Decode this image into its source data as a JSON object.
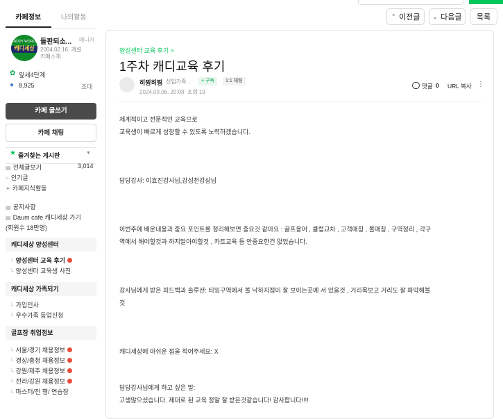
{
  "top": {
    "prev_label": "이전글",
    "next_label": "다음글",
    "list_label": "목록"
  },
  "sidebar": {
    "tabs": [
      "카페정보",
      "나의활동"
    ],
    "cafe": {
      "logo_text": "캐디세상",
      "name": "들판되소...",
      "role": "매니저",
      "date": "2004.02.16. 개설",
      "intro": "카페소개",
      "level": "잎새4단계",
      "member_count": "8,925",
      "invite": "초대"
    },
    "write_button": "카페 글쓰기",
    "chat_button": "카페 채팅",
    "favorites": "즐겨찾는 게시판",
    "menu1": [
      {
        "label": "전체글보기",
        "count": "3,014"
      },
      {
        "label": "인기글"
      },
      {
        "label": "카페지식활동"
      }
    ],
    "menu2": [
      {
        "label": "공지사항"
      },
      {
        "label": "Daum cafe 캐디세상 가기"
      },
      {
        "label": "(회원수 18만명)"
      }
    ],
    "section1": {
      "title": "캐디세상 양성센터",
      "items": [
        {
          "label": "양성센터 교육 후기",
          "new": true,
          "active": true
        },
        {
          "label": "양성센터 교육생 사진"
        }
      ]
    },
    "section2": {
      "title": "캐디세상 가족되기",
      "items": [
        {
          "label": "가입인사"
        },
        {
          "label": "우수가족 등업신청"
        }
      ]
    },
    "section3": {
      "title": "골프장 취업정보",
      "items": [
        {
          "label": "서울/경기 채용정보",
          "new": true
        },
        {
          "label": "경상/충청 채용정보",
          "new": true
        },
        {
          "label": "강원/제주 채용정보",
          "new": true
        },
        {
          "label": "전라/강원 채용정보",
          "new": true
        },
        {
          "label": "마스터/진 행/ 연습장"
        }
      ]
    }
  },
  "article": {
    "breadcrumb": "양성센터 교육 후기 >",
    "title": "1주차 캐디교육 후기",
    "author": "히찡히찡",
    "author_grade": "신입가족 ..",
    "follow_label": "+ 구독",
    "chat_label": "1:1 채팅",
    "date": "2024.09.06. 20:08",
    "views": "조회 19",
    "comment_label": "댓글",
    "comment_count": "0",
    "url_copy": "URL 복사",
    "body": [
      "체계적이고 전문적인 교육으로",
      "교육생이 빠르게 성장할 수 있도록 노력하겠습니다.",
      "담당강사:  이효진강사님,강성천강상님",
      "이번주에 배운내용과 중요 포인트를 정리해보면 중요것 같아요 :  골프용어 , 클럽교차 , 고객매칭 , 볼매칭 , 구역정리 , 각구",
      "역에서 해야할것과 하지말아야할것 , 카트교육 등 안중요한건 없었습니다.",
      "강사님에게 받은 피드백과 솔루션:  티잉구역에서 볼 낙하지점이 잘 보이는곳에 서 있을것 , 거리목보고 거리도 잘 파악해볼",
      "것",
      "캐디세상에 아쉬운 점을 적어주세요: X",
      "담당강사님에게 하고 싶은 말:",
      "고생많으셨습니다. 제대로 된 교육 정말 잘 받은것같습니다! 감사합니다!!!!"
    ]
  }
}
